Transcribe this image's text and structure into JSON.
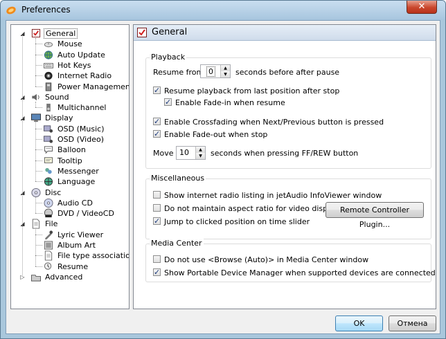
{
  "window": {
    "title": "Preferences",
    "close_glyph": "✕"
  },
  "tree": {
    "items": [
      {
        "label": "General",
        "icon": "general-icon",
        "level": 0,
        "expanded": true,
        "selected": true
      },
      {
        "label": "Mouse",
        "icon": "mouse-icon",
        "level": 1
      },
      {
        "label": "Auto Update",
        "icon": "globe-icon",
        "level": 1
      },
      {
        "label": "Hot Keys",
        "icon": "keyboard-icon",
        "level": 1
      },
      {
        "label": "Internet Radio",
        "icon": "radio-icon",
        "level": 1
      },
      {
        "label": "Power Management",
        "icon": "power-icon",
        "level": 1
      },
      {
        "label": "Sound",
        "icon": "speaker-icon",
        "level": 0,
        "expanded": true
      },
      {
        "label": "Multichannel",
        "icon": "multichannel-icon",
        "level": 1
      },
      {
        "label": "Display",
        "icon": "monitor-icon",
        "level": 0,
        "expanded": true
      },
      {
        "label": "OSD (Music)",
        "icon": "osd-music-icon",
        "level": 1
      },
      {
        "label": "OSD (Video)",
        "icon": "osd-video-icon",
        "level": 1
      },
      {
        "label": "Balloon",
        "icon": "balloon-icon",
        "level": 1
      },
      {
        "label": "Tooltip",
        "icon": "tooltip-icon",
        "level": 1
      },
      {
        "label": "Messenger",
        "icon": "messenger-icon",
        "level": 1
      },
      {
        "label": "Language",
        "icon": "language-icon",
        "level": 1
      },
      {
        "label": "Disc",
        "icon": "disc-icon",
        "level": 0,
        "expanded": true
      },
      {
        "label": "Audio CD",
        "icon": "audio-cd-icon",
        "level": 1
      },
      {
        "label": "DVD / VideoCD",
        "icon": "dvd-icon",
        "level": 1
      },
      {
        "label": "File",
        "icon": "file-icon",
        "level": 0,
        "expanded": true
      },
      {
        "label": "Lyric Viewer",
        "icon": "lyric-icon",
        "level": 1
      },
      {
        "label": "Album Art",
        "icon": "album-art-icon",
        "level": 1
      },
      {
        "label": "File type association",
        "icon": "file-type-icon",
        "level": 1
      },
      {
        "label": "Resume",
        "icon": "resume-icon",
        "level": 1
      },
      {
        "label": "Advanced",
        "icon": "advanced-icon",
        "level": 0,
        "expanded": false
      }
    ]
  },
  "panel": {
    "title": "General",
    "playback": {
      "title": "Playback",
      "resume_from_label": "Resume from",
      "resume_from_value": "0",
      "resume_suffix": "seconds before after pause",
      "resume_last_position": {
        "label": "Resume playback from last position after stop",
        "checked": true
      },
      "fade_in_resume": {
        "label": "Enable Fade-in when resume",
        "checked": true
      },
      "crossfading": {
        "label": "Enable Crossfading when Next/Previous button is pressed",
        "checked": true
      },
      "fade_out_stop": {
        "label": "Enable Fade-out when stop",
        "checked": true
      },
      "move_label": "Move",
      "move_value": "10",
      "move_suffix": "seconds when pressing FF/REW button"
    },
    "misc": {
      "title": "Miscellaneous",
      "internet_radio_listing": {
        "label": "Show internet radio listing in jetAudio InfoViewer window",
        "checked": false
      },
      "aspect_ratio": {
        "label": "Do not maintain aspect ratio for video display",
        "checked": false
      },
      "jump_slider": {
        "label": "Jump to clicked position on time slider",
        "checked": true
      },
      "remote_button": "Remote Controller Plugin..."
    },
    "media_center": {
      "title": "Media Center",
      "browse_auto": {
        "label": "Do not use <Browse (Auto)> in Media Center window",
        "checked": false
      },
      "portable_device": {
        "label": "Show Portable Device Manager when supported devices are connected",
        "checked": true
      }
    }
  },
  "footer": {
    "ok": "OK",
    "cancel": "Отмена"
  },
  "colors": {
    "titlebar": "#a9c7dc",
    "close": "#c9462c",
    "selection_border": "#555555",
    "check": "#1c3a7a"
  }
}
